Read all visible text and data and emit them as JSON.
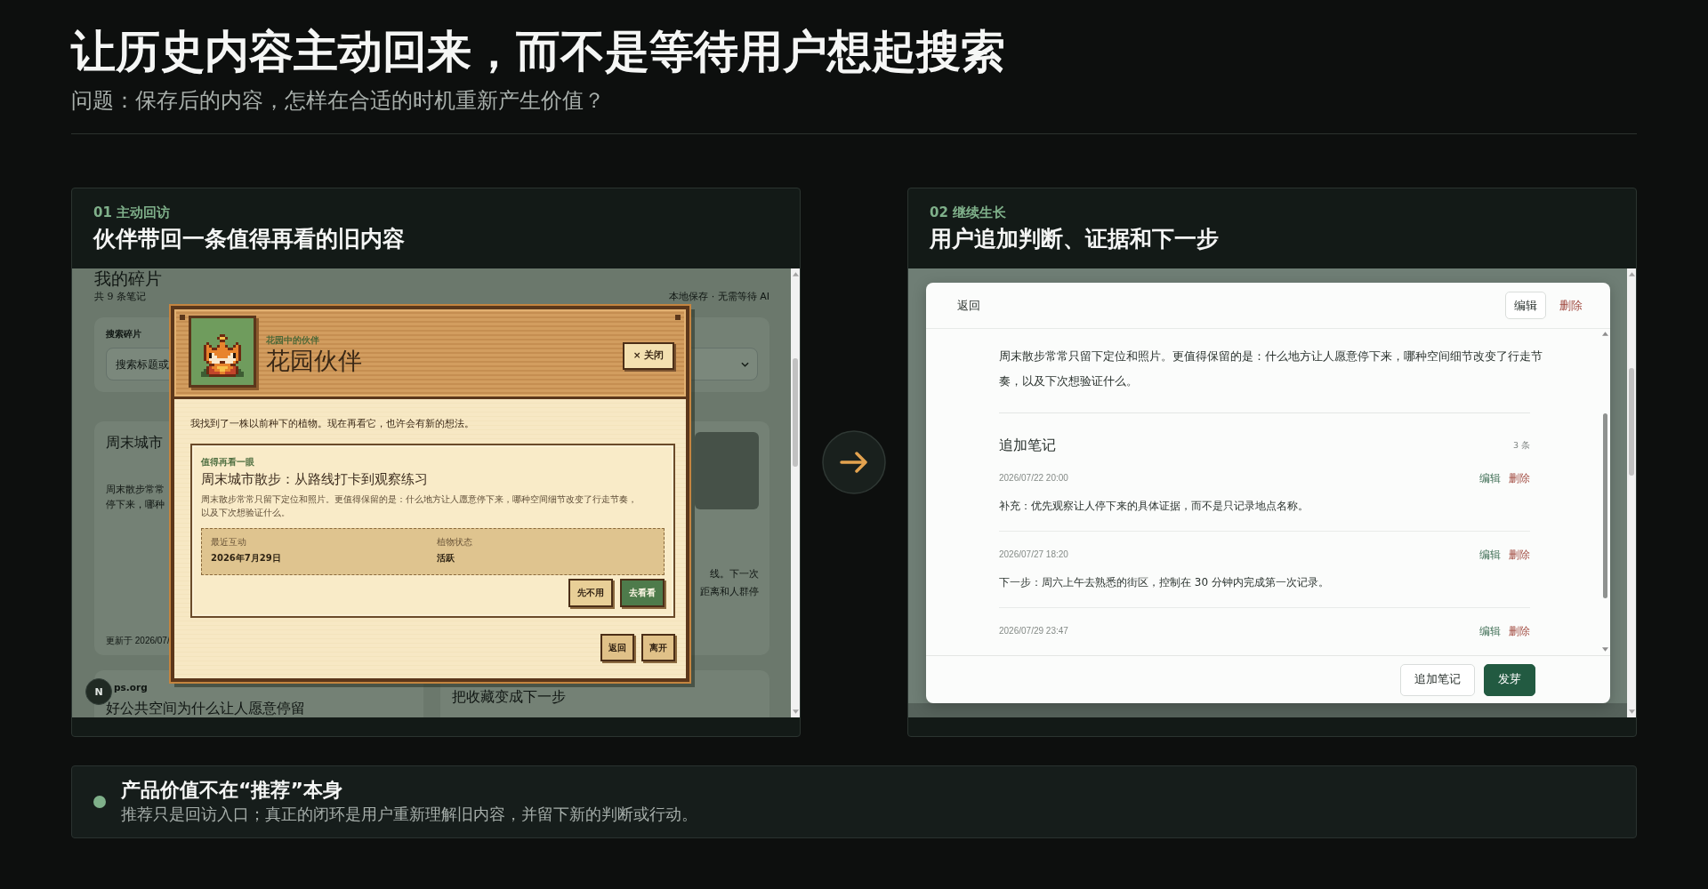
{
  "header": {
    "title": "让历史内容主动回来，而不是等待用户想起搜索",
    "subtitle": "问题：保存后的内容，怎样在合适的时机重新产生价值？"
  },
  "panels": [
    {
      "kind": "companion",
      "step": "01 主动回访",
      "title": "伙伴带回一条值得再看的旧内容",
      "screen": {
        "page_title": "我的碎片",
        "note_count": "共 9 条笔记",
        "storage_note": "本地保存 · 无需等待 AI",
        "search": {
          "label": "搜索碎片",
          "placeholder": "搜索标题或"
        },
        "cards": [
          {
            "photo": false,
            "title": "周末城市",
            "excerpt": [
              "周末散步常常",
              "停下来，哪种"
            ],
            "updated": "更新于 2026/07/"
          },
          {
            "photo": true,
            "excerpt": [
              "线。下一次",
              "距离和人群停"
            ]
          },
          {
            "photo": false,
            "source": "ps.org",
            "title": "好公共空间为什么让人愿意停留"
          },
          {
            "photo": false,
            "title": "把收藏变成下一步"
          }
        ],
        "dev_badge": "N",
        "dialog": {
          "eyebrow": "花园中的伙伴",
          "title": "花园伙伴",
          "close": "× 关闭",
          "message": "我找到了一株以前种下的植物。现在再看它，也许会有新的想法。",
          "suggestion": {
            "tag": "值得再看一眼",
            "title": "周末城市散步：从路线打卡到观察练习",
            "summary": "周末散步常常只留下定位和照片。更值得保留的是：什么地方让人愿意停下来，哪种空间细节改变了行走节奏，以及下次想验证什么。",
            "facts": [
              {
                "label": "最近互动",
                "value": "2026年7月29日"
              },
              {
                "label": "植物状态",
                "value": "活跃"
              }
            ],
            "actions": [
              {
                "label": "先不用",
                "kind": "secondary"
              },
              {
                "label": "去看看",
                "kind": "primary"
              }
            ]
          },
          "actions": [
            {
              "label": "返回",
              "kind": "secondary"
            },
            {
              "label": "离开",
              "kind": "secondary"
            }
          ]
        }
      }
    },
    {
      "kind": "detail",
      "step": "02 继续生长",
      "title": "用户追加判断、证据和下一步",
      "screen": {
        "dialog": {
          "back": "返回",
          "edit": "编辑",
          "delete": "删除",
          "body": "周末散步常常只留下定位和照片。更值得保留的是：什么地方让人愿意停下来，哪种空间细节改变了行走节奏，以及下次想验证什么。",
          "notes_title": "追加笔记",
          "notes_count": "3 条",
          "notes": [
            {
              "time": "2026/07/22 20:00",
              "edit": "编辑",
              "delete": "删除",
              "text": "补充：优先观察让人停下来的具体证据，而不是只记录地点名称。"
            },
            {
              "time": "2026/07/27 18:20",
              "edit": "编辑",
              "delete": "删除",
              "text": "下一步：周六上午去熟悉的街区，控制在 30 分钟内完成第一次记录。"
            },
            {
              "time": "2026/07/29 23:47",
              "edit": "编辑",
              "delete": "删除"
            }
          ],
          "footer_actions": [
            {
              "label": "追加笔记",
              "kind": "secondary"
            },
            {
              "label": "发芽",
              "kind": "primary"
            }
          ]
        }
      }
    }
  ],
  "takeaway": {
    "title": "产品价值不在“推荐”本身",
    "text": "推荐只是回访入口；真正的闭环是用户重新理解旧内容，并留下新的判断或行动。"
  }
}
